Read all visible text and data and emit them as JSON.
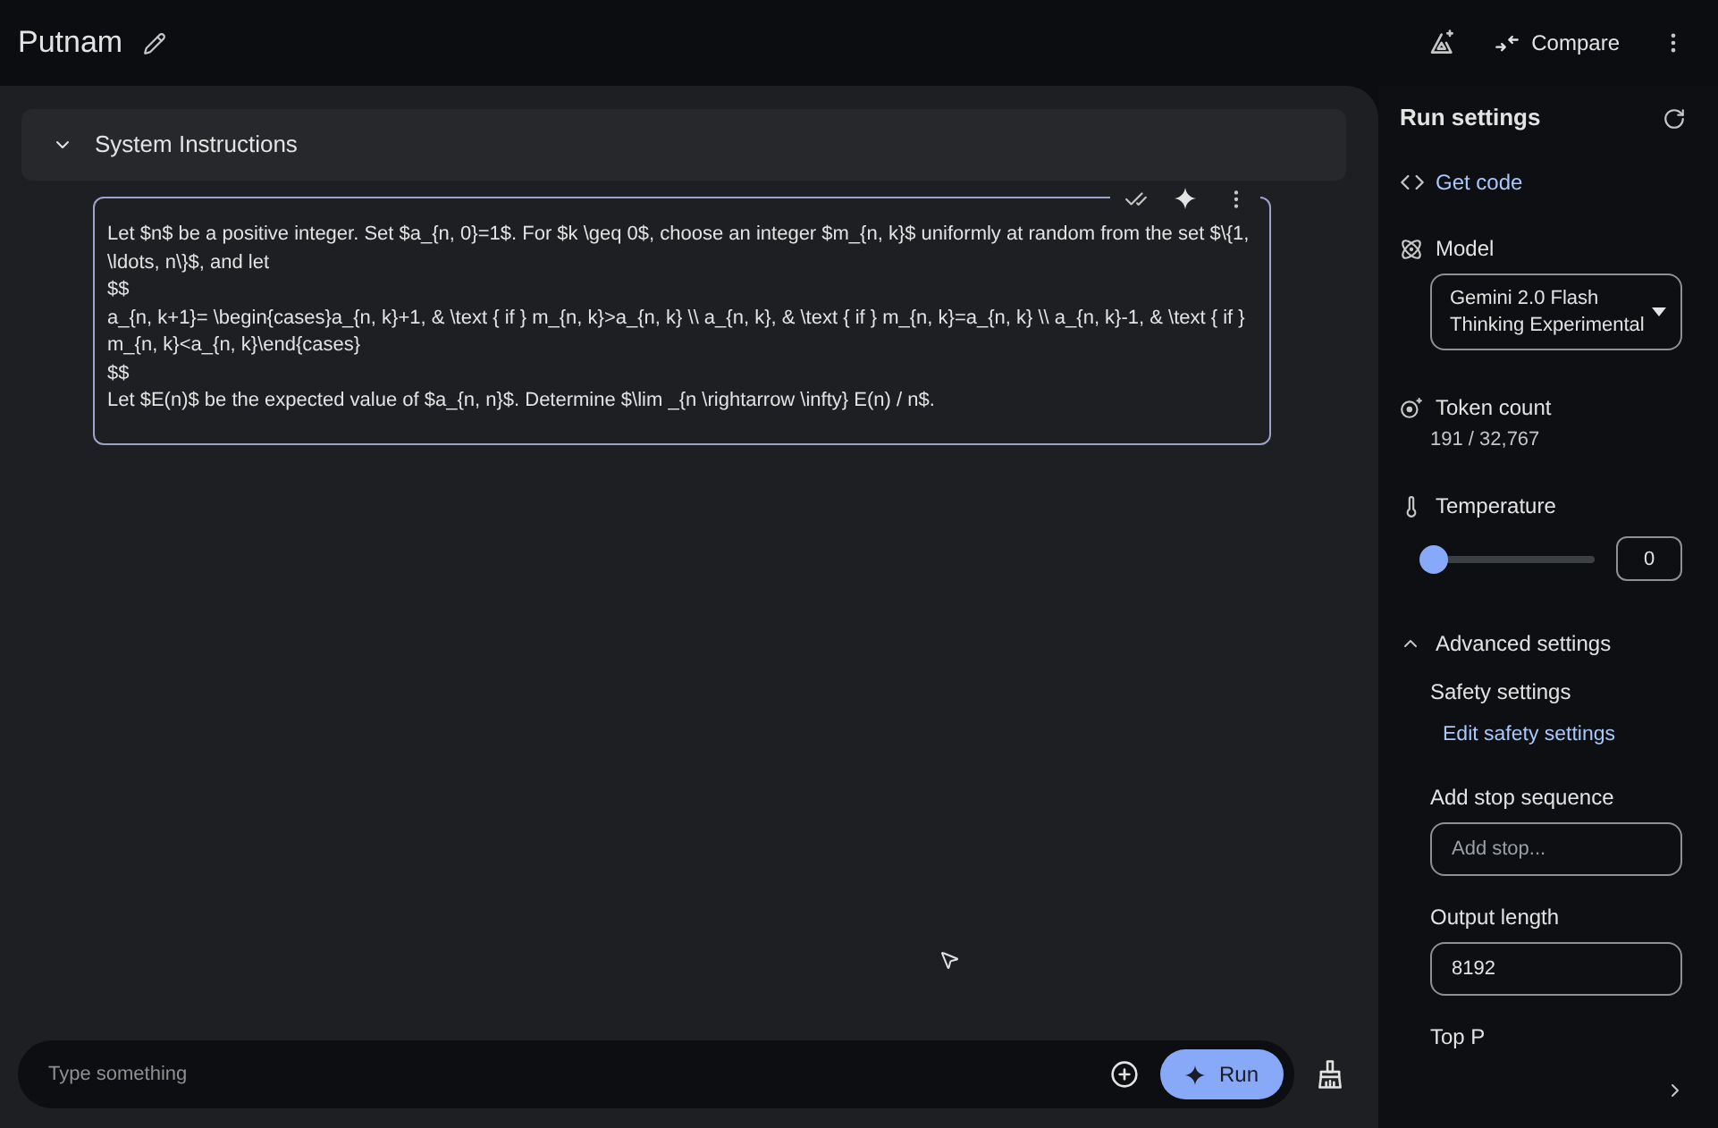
{
  "header": {
    "title": "Putnam",
    "compare_label": "Compare"
  },
  "system_instructions": {
    "title": "System Instructions",
    "expanded": true,
    "value": "Let $n$ be a positive integer. Set $a_{n, 0}=1$. For $k \\geq 0$, choose an integer $m_{n, k}$ uniformly at random from the set $\\{1, \\ldots, n\\}$, and let\n$$\na_{n, k+1}= \\begin{cases}a_{n, k}+1, & \\text { if } m_{n, k}>a_{n, k} \\\\ a_{n, k}, & \\text { if } m_{n, k}=a_{n, k} \\\\ a_{n, k}-1, & \\text { if } m_{n, k}<a_{n, k}\\end{cases}\n$$\nLet $E(n)$ be the expected value of $a_{n, n}$. Determine $\\lim _{n \\rightarrow \\infty} E(n) / n$."
  },
  "prompt": {
    "placeholder": "Type something",
    "run_label": "Run"
  },
  "run_settings": {
    "title": "Run settings",
    "get_code": "Get code",
    "model": {
      "label": "Model",
      "value": "Gemini 2.0 Flash Thinking Experimental"
    },
    "token_count": {
      "label": "Token count",
      "value": "191 / 32,767"
    },
    "temperature": {
      "label": "Temperature",
      "level": 0,
      "value": "0"
    },
    "advanced": {
      "label": "Advanced settings",
      "expanded": true,
      "safety": {
        "label": "Safety settings",
        "link": "Edit safety settings"
      },
      "stop_sequence": {
        "label": "Add stop sequence",
        "placeholder": "Add stop..."
      },
      "output_length": {
        "label": "Output length",
        "value": "8192"
      },
      "top_p": {
        "label": "Top P"
      }
    }
  }
}
